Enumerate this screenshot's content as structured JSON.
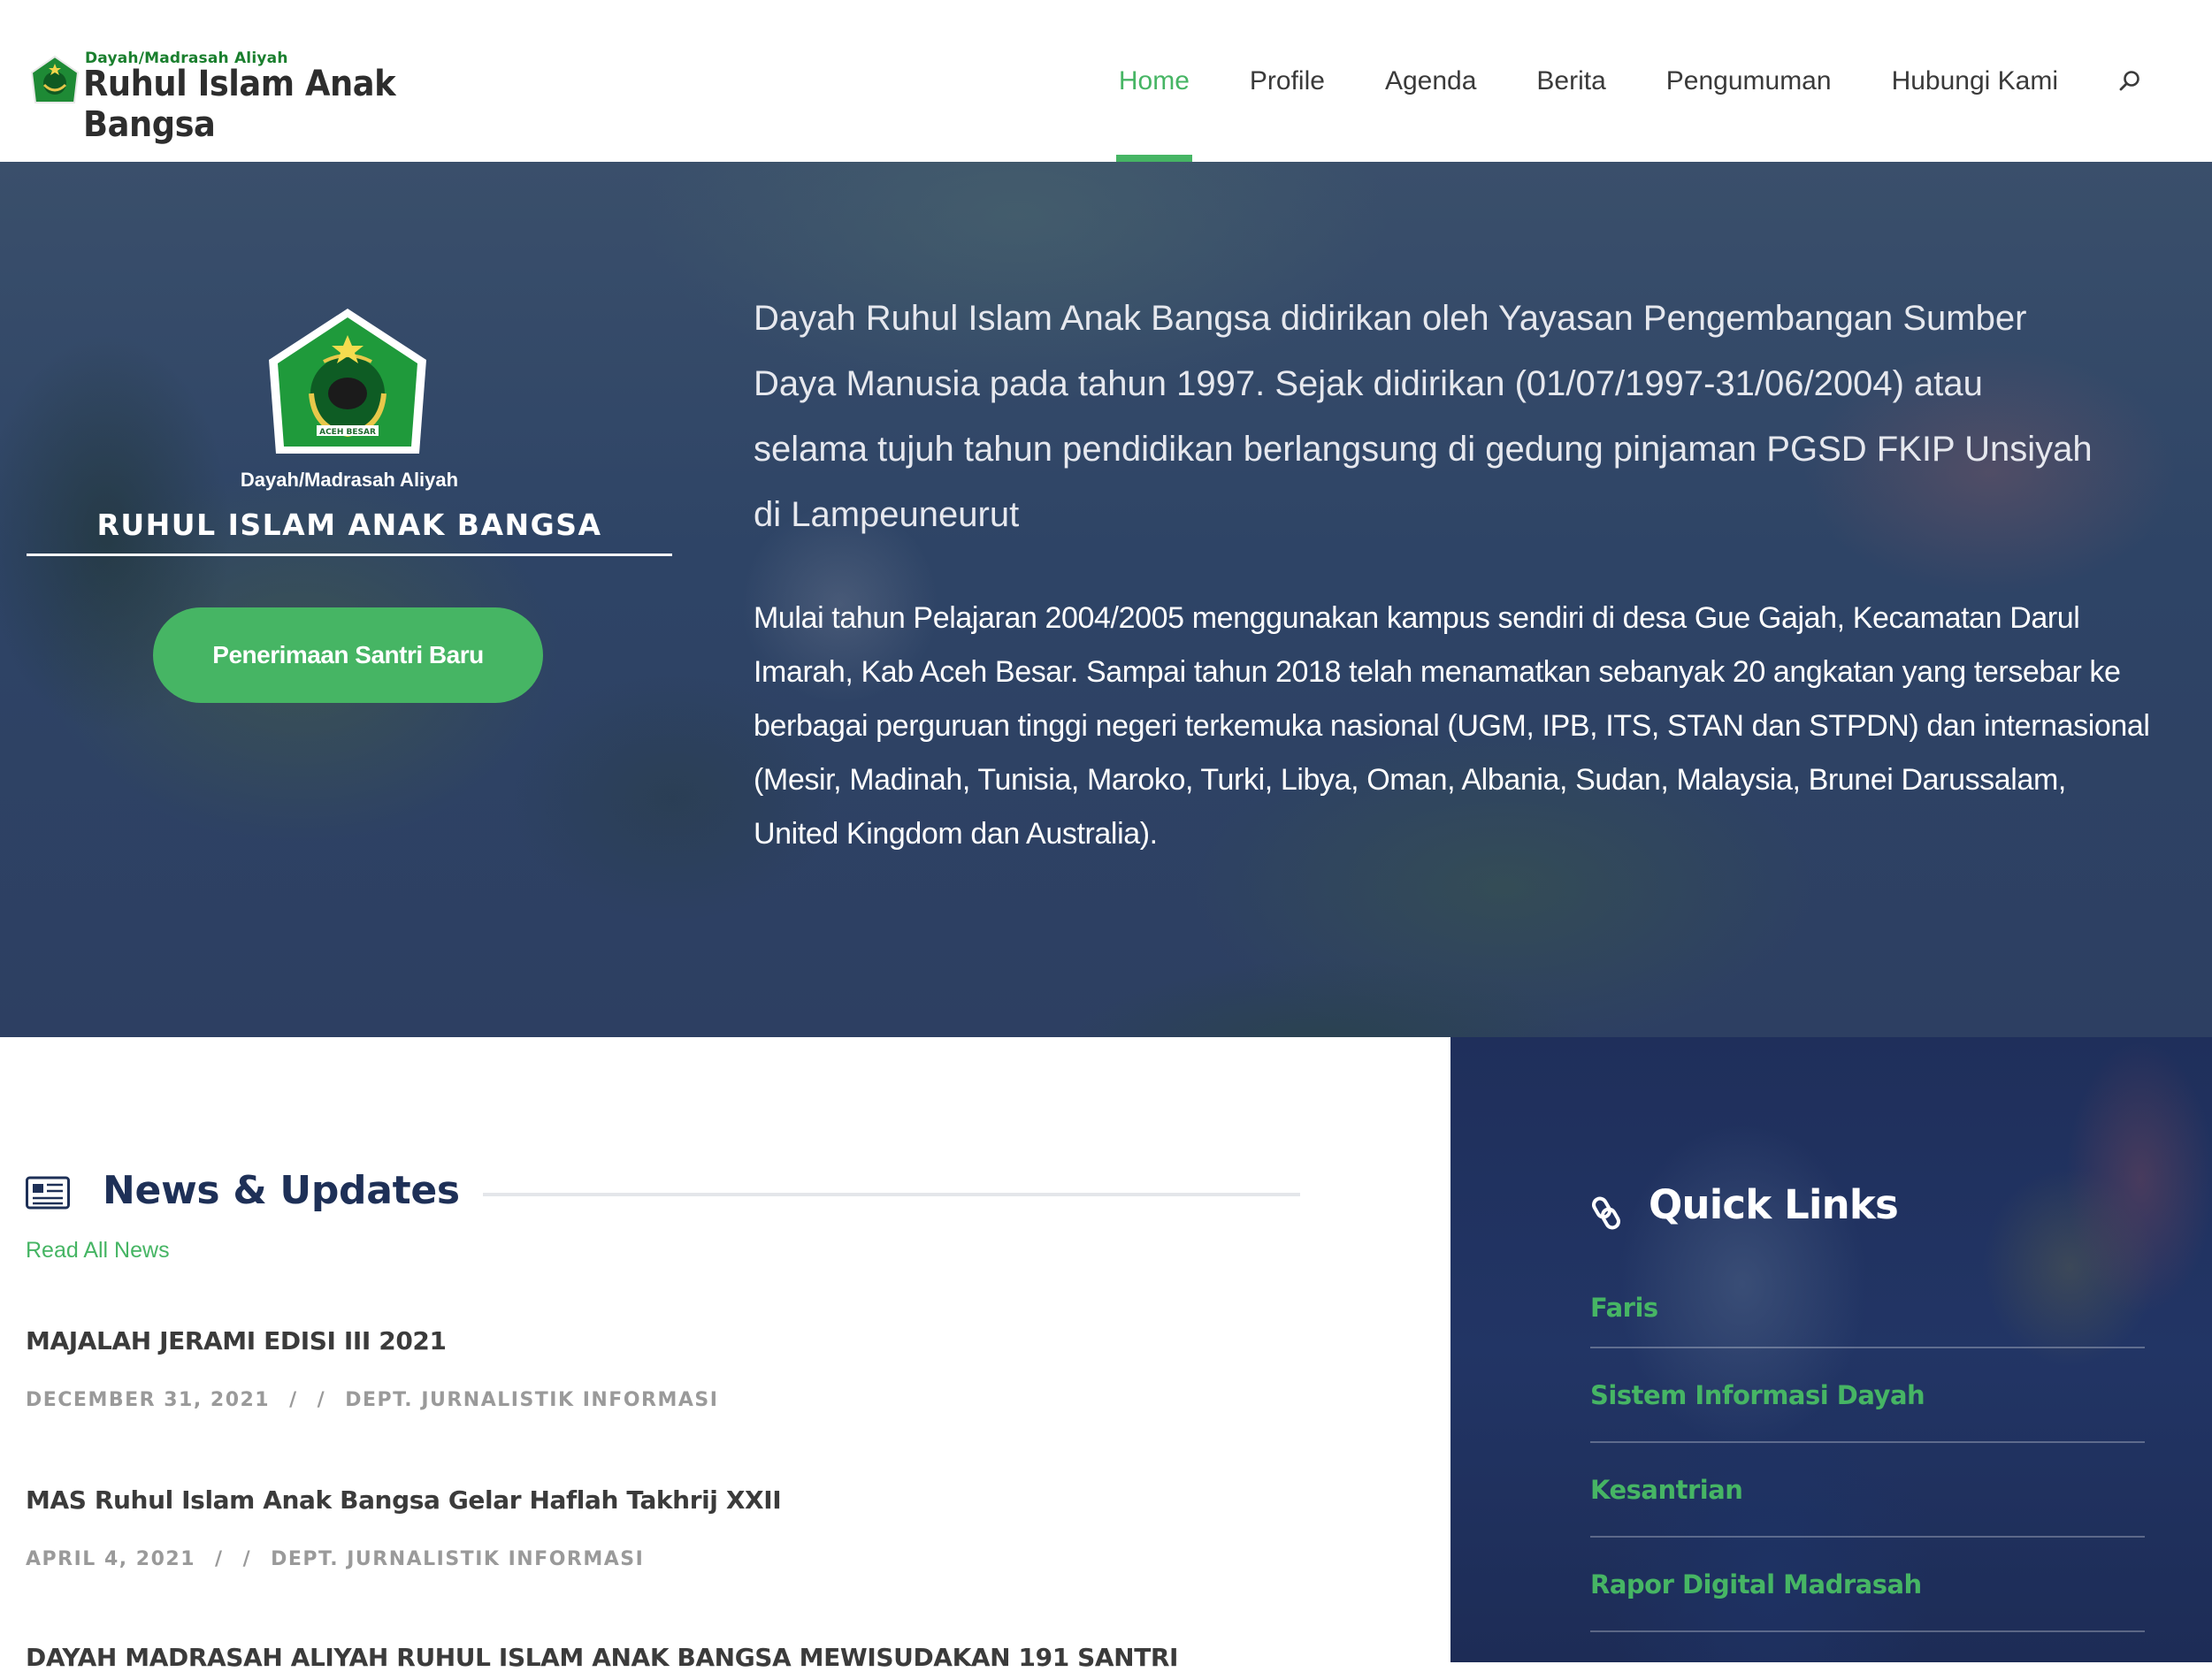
{
  "colors": {
    "accent": "#46b564",
    "navy": "#1e3057"
  },
  "header": {
    "logo_small": "Dayah/Madrasah Aliyah",
    "logo_name": "Ruhul Islam Anak Bangsa",
    "nav": [
      {
        "label": "Home",
        "active": true
      },
      {
        "label": "Profile"
      },
      {
        "label": "Agenda"
      },
      {
        "label": "Berita"
      },
      {
        "label": "Pengumuman"
      },
      {
        "label": "Hubungi Kami"
      }
    ],
    "search_icon": "search-icon"
  },
  "hero": {
    "emblem_caption": "ACEH BESAR",
    "school_type": "Dayah/Madrasah Aliyah",
    "school_name": "RUHUL ISLAM ANAK BANGSA",
    "cta": "Penerimaan Santri Baru",
    "paragraph1": "Dayah Ruhul Islam Anak Bangsa didirikan oleh Yayasan Pengembangan Sumber Daya Manusia pada tahun 1997. Sejak didirikan (01/07/1997-31/06/2004) atau selama tujuh tahun pendidikan berlangsung di gedung pinjaman PGSD FKIP Unsiyah di Lampeuneurut",
    "paragraph2": "Mulai tahun Pelajaran 2004/2005 menggunakan kampus sendiri di desa Gue Gajah, Kecamatan Darul Imarah, Kab Aceh Besar. Sampai tahun 2018 telah menamatkan sebanyak 20 angkatan yang tersebar ke berbagai perguruan tinggi negeri terkemuka nasional (UGM, IPB, ITS, STAN dan STPDN) dan internasional (Mesir, Madinah, Tunisia, Maroko, Turki, Libya, Oman, Albania, Sudan, Malaysia, Brunei Darussalam, United Kingdom dan Australia)."
  },
  "news": {
    "title": "News & Updates",
    "read_all": "Read All News",
    "separator": "/",
    "items": [
      {
        "title": "MAJALAH JERAMI EDISI III 2021",
        "date": "DECEMBER 31, 2021",
        "author": "DEPT. JURNALISTIK INFORMASI"
      },
      {
        "title": "MAS Ruhul Islam Anak Bangsa Gelar Haflah Takhrij XXII",
        "date": "APRIL 4, 2021",
        "author": "DEPT. JURNALISTIK INFORMASI"
      },
      {
        "title": "DAYAH MADRASAH ALIYAH RUHUL ISLAM ANAK BANGSA MEWISUDAKAN 191 SANTRI"
      }
    ]
  },
  "quick_links": {
    "title": "Quick Links",
    "items": [
      "Faris",
      "Sistem Informasi Dayah",
      "Kesantrian",
      "Rapor Digital Madrasah"
    ]
  }
}
